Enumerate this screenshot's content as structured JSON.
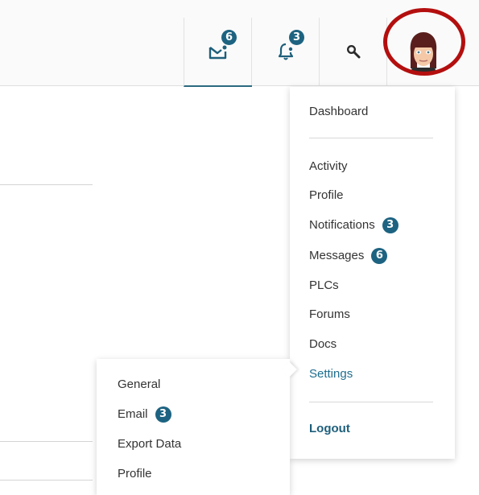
{
  "header": {
    "messages_badge": "6",
    "notifications_badge": "3",
    "icons": [
      "envelope-icon",
      "bell-icon",
      "search-icon"
    ],
    "avatar": "user-avatar",
    "highlight_color": "#b40f0f"
  },
  "account_menu": {
    "dashboard": "Dashboard",
    "activity": "Activity",
    "profile": "Profile",
    "notifications": {
      "label": "Notifications",
      "badge": "3"
    },
    "messages": {
      "label": "Messages",
      "badge": "6"
    },
    "plcs": "PLCs",
    "forums": "Forums",
    "docs": "Docs",
    "settings": "Settings",
    "logout": "Logout"
  },
  "settings_submenu": {
    "general": "General",
    "email": {
      "label": "Email",
      "badge": "3"
    },
    "export_data": "Export Data",
    "profile": "Profile"
  },
  "colors": {
    "accent": "#1d6381",
    "active_link": "#1f6d8e"
  }
}
